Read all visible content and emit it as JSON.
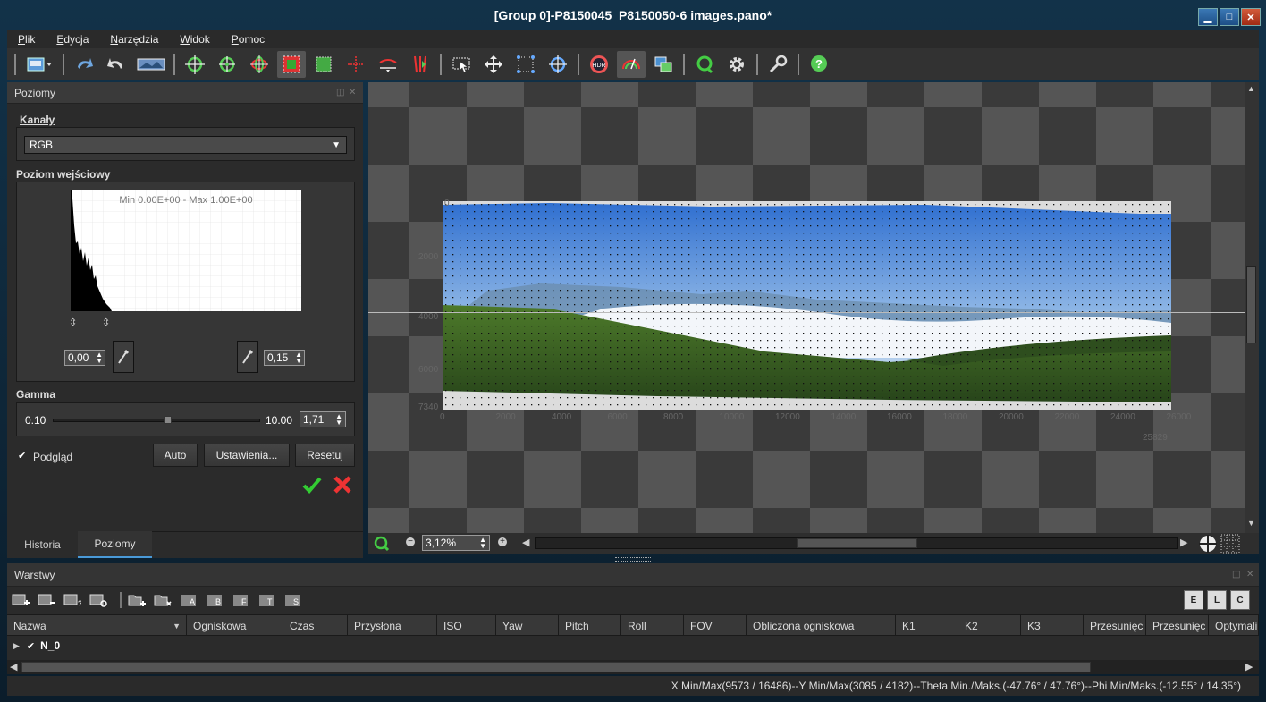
{
  "window": {
    "title": "[Group 0]-P8150045_P8150050-6 images.pano*",
    "min": "▁",
    "max": "□",
    "close": "✕"
  },
  "menu": [
    "Plik",
    "Edycja",
    "Narzędzia",
    "Widok",
    "Pomoc"
  ],
  "toolbar": {
    "icons": [
      "new-document-icon",
      "undo-icon",
      "redo-icon",
      "panorama-icon",
      "crosshair-green-icon",
      "crosshair-green-small-icon",
      "rotate-crosshair-icon",
      "crop-select-icon",
      "fit-square-icon",
      "center-cross-icon",
      "horizon-icon",
      "vertical-lines-icon",
      "select-arrow-icon",
      "move-arrows-icon",
      "grid-dots-icon",
      "target-icon",
      "hdr-icon",
      "levels-icon",
      "images-icon",
      "zoom-refresh-icon",
      "gear-icon",
      "wrench-icon",
      "help-icon"
    ]
  },
  "levels": {
    "panel_title": "Poziomy",
    "channels_label": "Kanały",
    "channel_value": "RGB",
    "input_level_label": "Poziom wejściowy",
    "histogram_caption": "Min 0.00E+00 - Max 1.00E+00",
    "min_value": "0,00",
    "max_value": "0,15",
    "gamma_label": "Gamma",
    "gamma_min": "0.10",
    "gamma_max": "10.00",
    "gamma_value": "1,71",
    "gamma_fraction": 0.55,
    "preview_label": "Podgląd",
    "auto": "Auto",
    "settings": "Ustawienia...",
    "reset": "Resetuj"
  },
  "tabs": {
    "history": "Historia",
    "levels": "Poziomy"
  },
  "viewport": {
    "x_ticks": [
      "0",
      "2000",
      "4000",
      "6000",
      "8000",
      "10000",
      "12000",
      "14000",
      "16000",
      "18000",
      "20000",
      "22000",
      "24000",
      "26000"
    ],
    "x_extra": "25829",
    "y_ticks": [
      "0",
      "2000",
      "4000",
      "6000",
      "7340"
    ],
    "zoom": "3,12%"
  },
  "layers": {
    "title": "Warstwy",
    "columns": [
      "Nazwa",
      "Ogniskowa",
      "Czas",
      "Przysłona",
      "ISO",
      "Yaw",
      "Pitch",
      "Roll",
      "FOV",
      "Obliczona ogniskowa",
      "K1",
      "K2",
      "K3",
      "Przesunięc",
      "Przesunięc",
      "Optymali"
    ],
    "row_name": "N_0",
    "right_buttons": [
      "E",
      "L",
      "C"
    ]
  },
  "status": {
    "x": "X Min/Max(9573 / 16486)",
    "y": "Y Min/Max(3085 / 4182)",
    "theta": "Theta Min./Maks.(-47.76° / 47.76°)",
    "phi": "Phi Min/Maks.(-12.55° / 14.35°)",
    "sep": "--"
  }
}
